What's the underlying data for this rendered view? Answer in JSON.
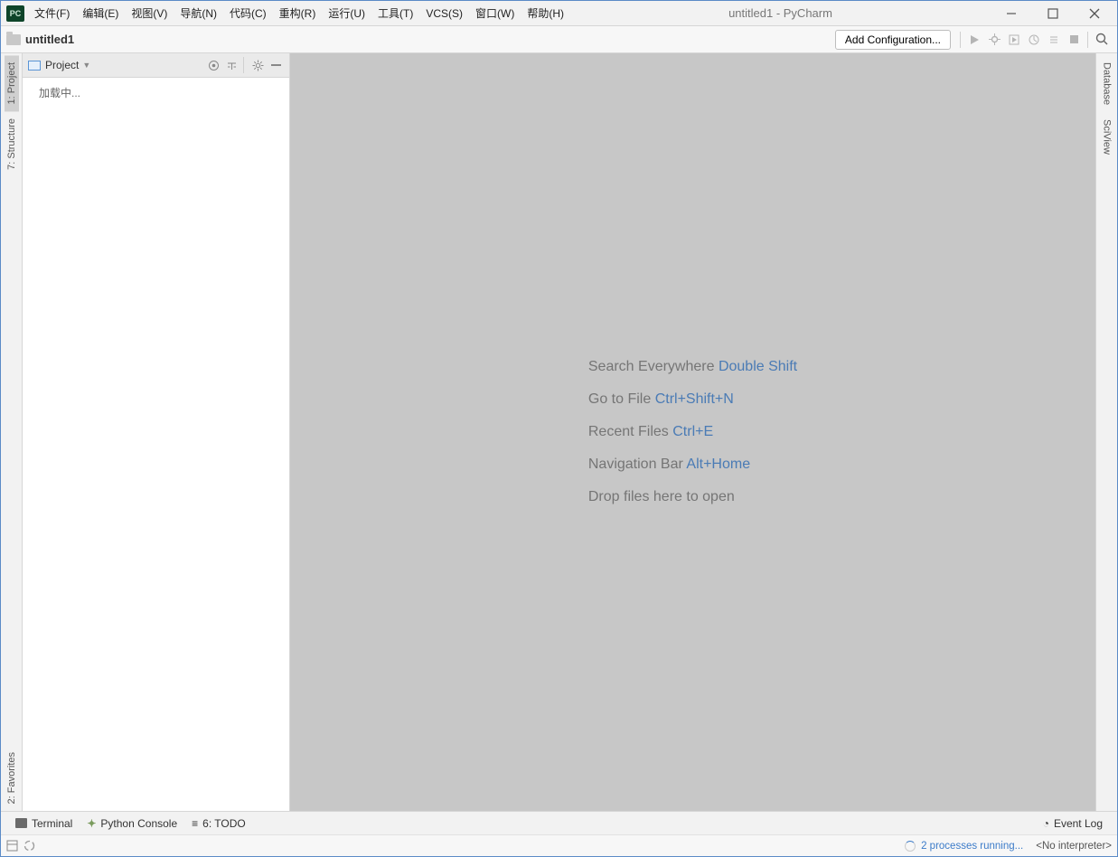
{
  "window": {
    "title": "untitled1 - PyCharm"
  },
  "menu": {
    "file": "文件(F)",
    "edit": "编辑(E)",
    "view": "视图(V)",
    "navigate": "导航(N)",
    "code": "代码(C)",
    "refactor": "重构(R)",
    "run": "运行(U)",
    "tools": "工具(T)",
    "vcs": "VCS(S)",
    "window": "窗口(W)",
    "help": "帮助(H)"
  },
  "nav": {
    "project_name": "untitled1",
    "config_button": "Add Configuration..."
  },
  "left_rail": {
    "project": "1: Project",
    "structure": "7: Structure",
    "favorites": "2: Favorites"
  },
  "right_rail": {
    "database": "Database",
    "sciview": "SciView"
  },
  "project_panel": {
    "title": "Project",
    "loading": "加载中..."
  },
  "editor_hints": {
    "search": {
      "label": "Search Everywhere ",
      "key": "Double Shift"
    },
    "goto": {
      "label": "Go to File ",
      "key": "Ctrl+Shift+N"
    },
    "recent": {
      "label": "Recent Files ",
      "key": "Ctrl+E"
    },
    "navbar": {
      "label": "Navigation Bar ",
      "key": "Alt+Home"
    },
    "drop": {
      "label": "Drop files here to open"
    }
  },
  "bottom_tabs": {
    "terminal": "Terminal",
    "python_console": "Python Console",
    "todo": "6: TODO",
    "event_log": "Event Log"
  },
  "status": {
    "processes": "2 processes running...",
    "interpreter": "<No interpreter>"
  }
}
